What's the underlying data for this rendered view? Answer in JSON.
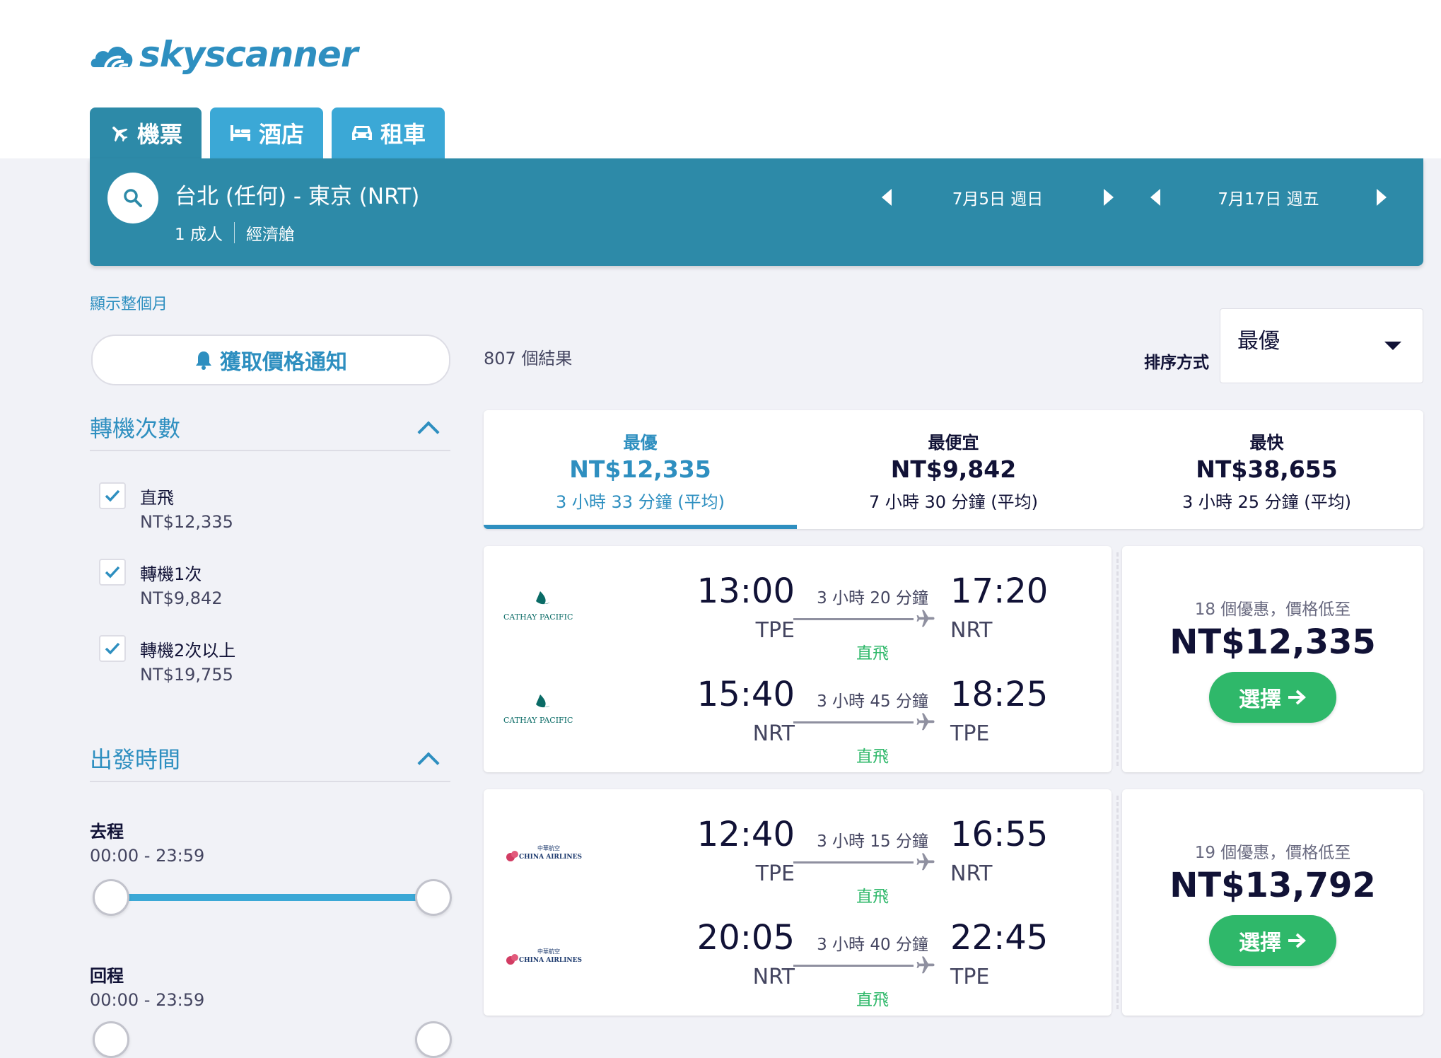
{
  "brand": {
    "logo_text": "skyscanner"
  },
  "tabs": [
    {
      "label": "機票",
      "icon": "plane-icon"
    },
    {
      "label": "酒店",
      "icon": "bed-icon"
    },
    {
      "label": "租車",
      "icon": "car-icon"
    }
  ],
  "search": {
    "route": "台北 (任何) - 東京 (NRT)",
    "passengers": "1 成人",
    "cabin": "經濟艙",
    "depart_date": "7月5日 週日",
    "return_date": "7月17日 週五"
  },
  "show_month_link": "顯示整個月",
  "price_alert_label": "獲取價格通知",
  "filters": {
    "stops_title": "轉機次數",
    "stops": [
      {
        "label": "直飛",
        "price": "NT$12,335",
        "checked": true
      },
      {
        "label": "轉機1次",
        "price": "NT$9,842",
        "checked": true
      },
      {
        "label": "轉機2次以上",
        "price": "NT$19,755",
        "checked": true
      }
    ],
    "times_title": "出發時間",
    "outbound_label": "去程",
    "outbound_range": "00:00 - 23:59",
    "return_label": "回程",
    "return_range": "00:00 - 23:59"
  },
  "results": {
    "count_text": "807 個結果",
    "sort_label": "排序方式",
    "sort_value": "最優"
  },
  "summary_tabs": [
    {
      "title": "最優",
      "price": "NT$12,335",
      "duration": "3 小時 33 分鐘 (平均)",
      "active": true
    },
    {
      "title": "最便宜",
      "price": "NT$9,842",
      "duration": "7 小時 30 分鐘 (平均)",
      "active": false
    },
    {
      "title": "最快",
      "price": "NT$38,655",
      "duration": "3 小時 25 分鐘 (平均)",
      "active": false
    }
  ],
  "itineraries": [
    {
      "airline": "CATHAY PACIFIC",
      "legs": [
        {
          "dep_time": "13:00",
          "dep_code": "TPE",
          "duration": "3 小時 20 分鐘",
          "stops": "直飛",
          "arr_time": "17:20",
          "arr_code": "NRT"
        },
        {
          "dep_time": "15:40",
          "dep_code": "NRT",
          "duration": "3 小時 45 分鐘",
          "stops": "直飛",
          "arr_time": "18:25",
          "arr_code": "TPE"
        }
      ],
      "offers": "18 個優惠，價格低至",
      "price": "NT$12,335",
      "select_label": "選擇"
    },
    {
      "airline": "CHINA AIRLINES",
      "airline_native": "中華航空",
      "legs": [
        {
          "dep_time": "12:40",
          "dep_code": "TPE",
          "duration": "3 小時 15 分鐘",
          "stops": "直飛",
          "arr_time": "16:55",
          "arr_code": "NRT"
        },
        {
          "dep_time": "20:05",
          "dep_code": "NRT",
          "duration": "3 小時 40 分鐘",
          "stops": "直飛",
          "arr_time": "22:45",
          "arr_code": "TPE"
        }
      ],
      "offers": "19 個優惠，價格低至",
      "price": "NT$13,792",
      "select_label": "選擇"
    }
  ],
  "colors": {
    "brand_blue": "#2e8fc0",
    "search_bar": "#2d8aa8",
    "tab_inactive": "#3ba8d6",
    "select_green": "#2fb86a",
    "page_bg": "#f1f2f7"
  }
}
